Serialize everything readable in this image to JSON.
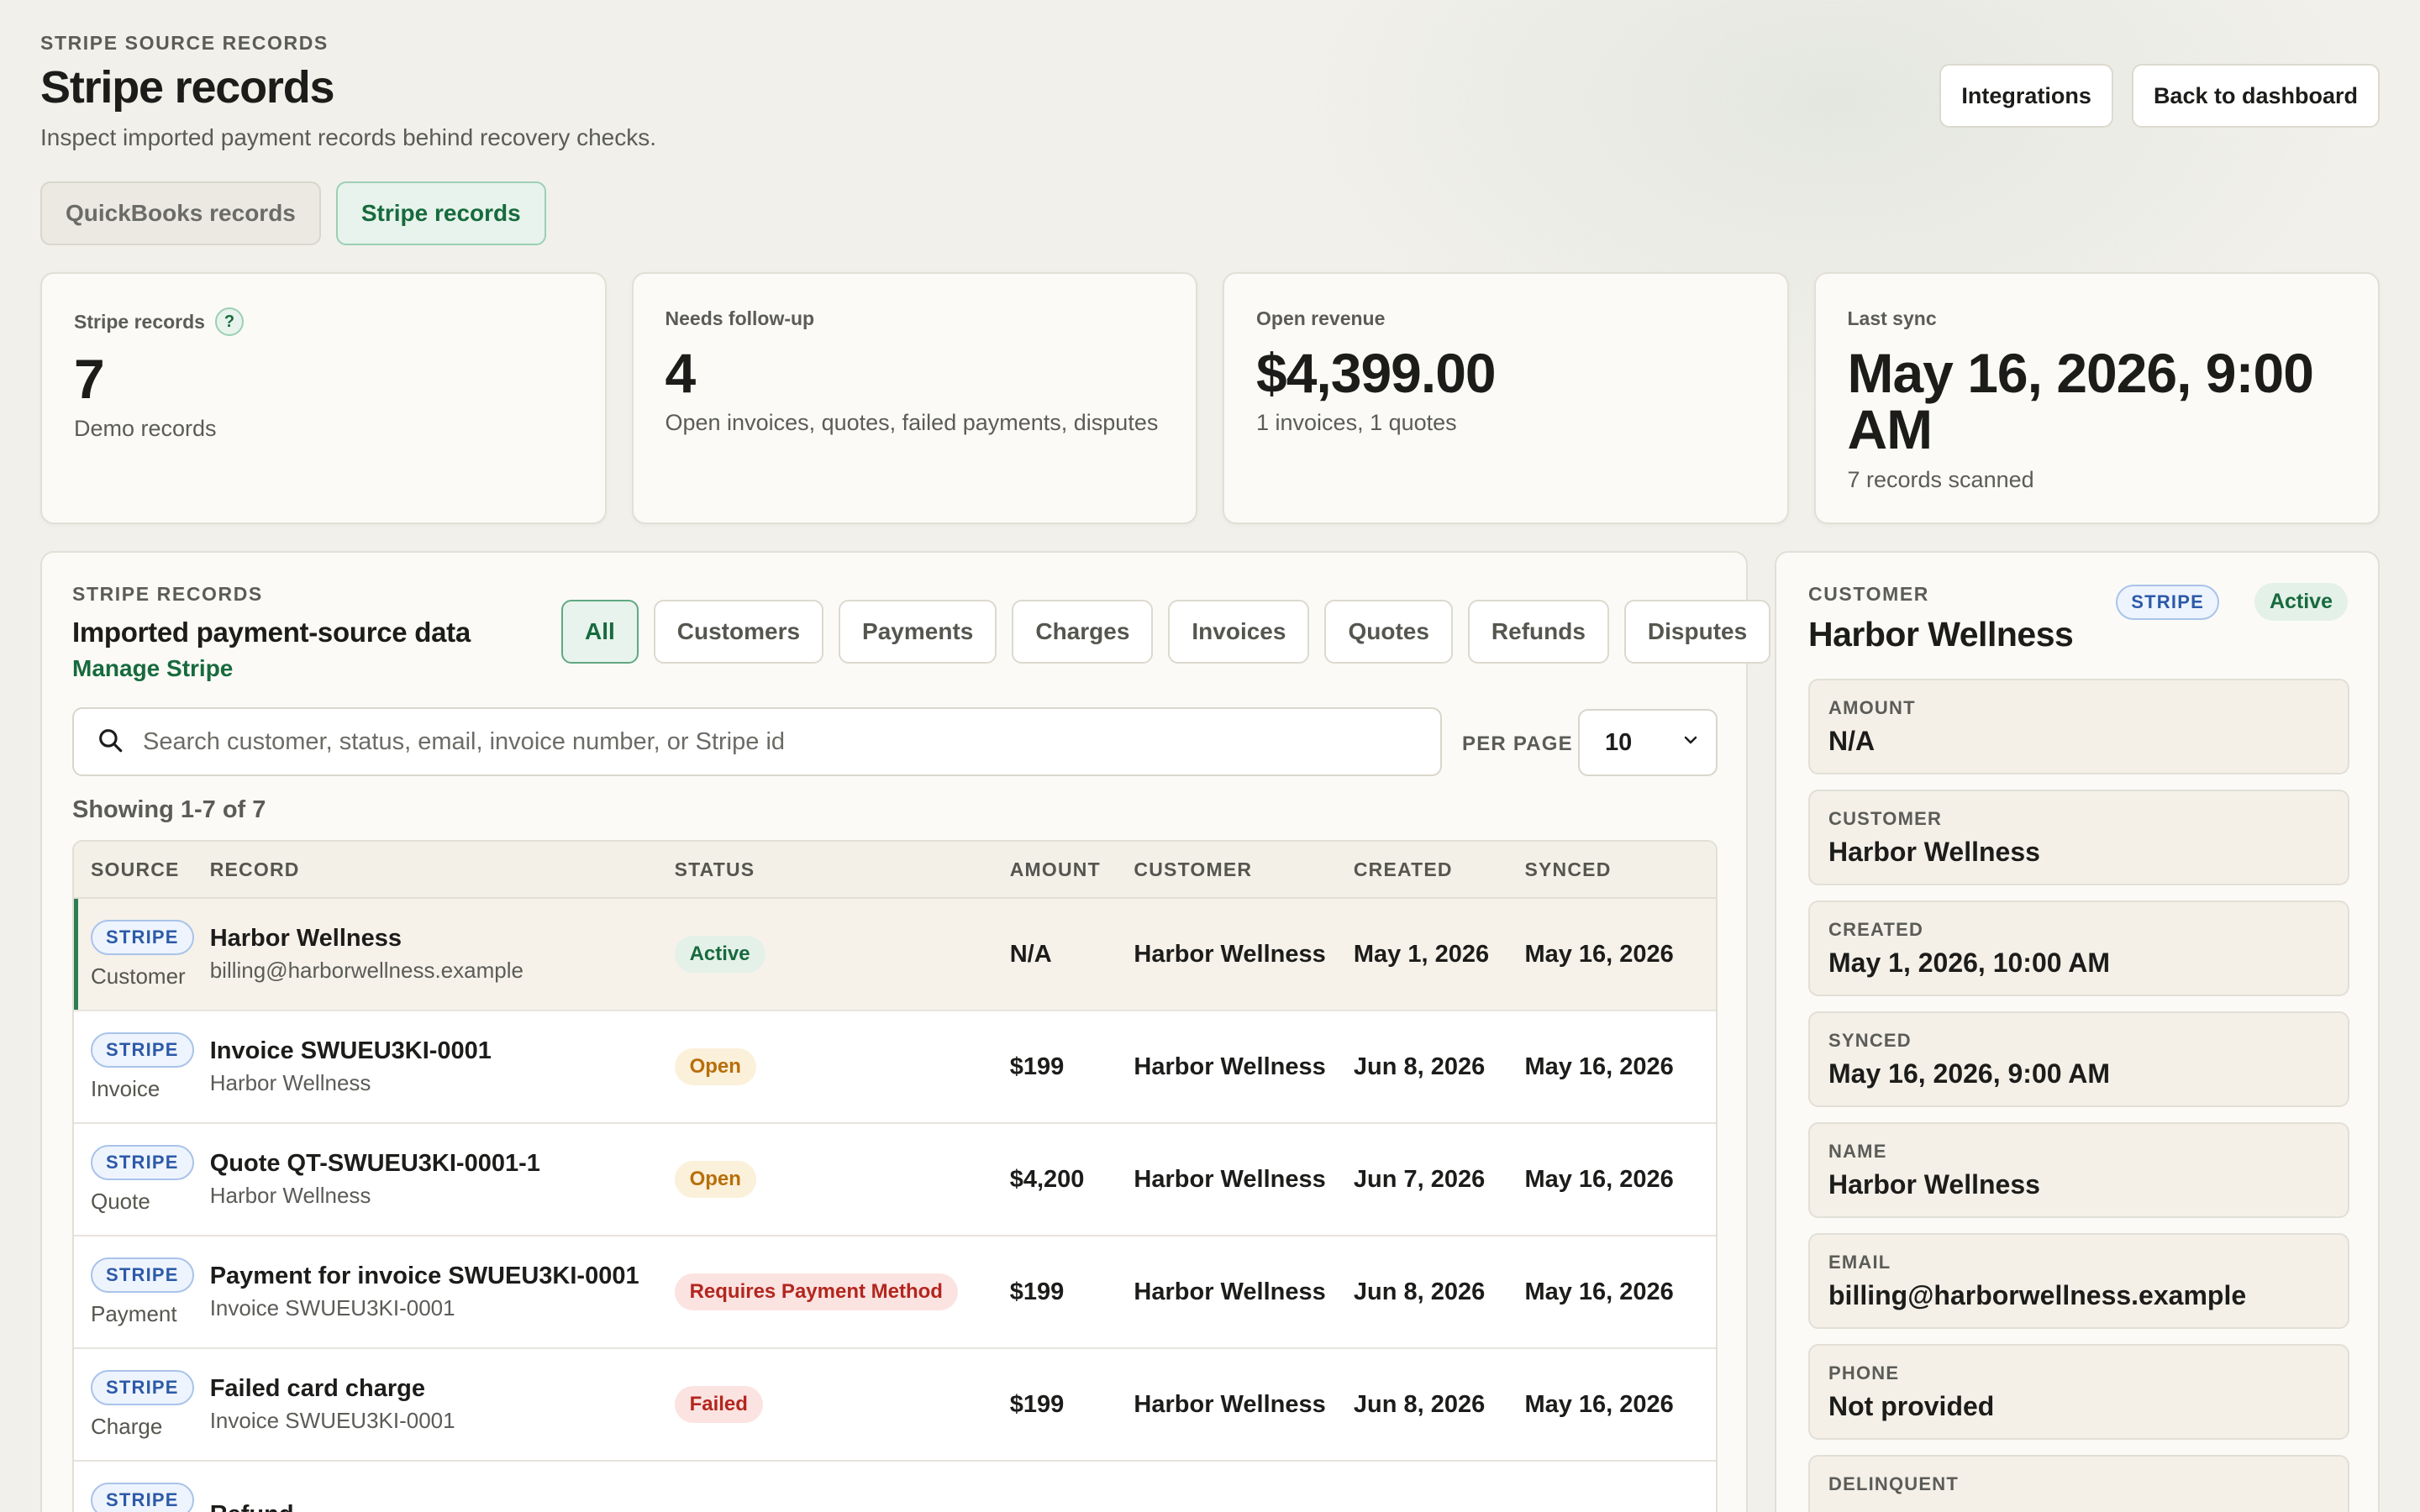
{
  "header": {
    "eyebrow": "STRIPE SOURCE RECORDS",
    "title": "Stripe records",
    "subtitle": "Inspect imported payment records behind recovery checks.",
    "integrations_label": "Integrations",
    "back_label": "Back to dashboard"
  },
  "source_tabs": [
    {
      "label": "QuickBooks records",
      "active": false
    },
    {
      "label": "Stripe records",
      "active": true
    }
  ],
  "stats": [
    {
      "label": "Stripe records",
      "value": "7",
      "desc": "Demo records",
      "help": "?"
    },
    {
      "label": "Needs follow-up",
      "value": "4",
      "desc": "Open invoices, quotes, failed payments, disputes"
    },
    {
      "label": "Open revenue",
      "value": "$4,399.00",
      "desc": "1 invoices, 1 quotes"
    },
    {
      "label": "Last sync",
      "value": "May 16, 2026, 9:00 AM",
      "desc": "7 records scanned"
    }
  ],
  "records_panel": {
    "eyebrow": "STRIPE RECORDS",
    "title": "Imported payment-source data",
    "manage_link": "Manage Stripe",
    "filters": [
      "All",
      "Customers",
      "Payments",
      "Charges",
      "Invoices",
      "Quotes",
      "Refunds",
      "Disputes"
    ],
    "active_filter": "All",
    "search_placeholder": "Search customer, status, email, invoice number, or Stripe id",
    "search_value": "",
    "per_page_label": "PER PAGE",
    "per_page_value": "10",
    "showing": "Showing 1-7 of 7"
  },
  "table": {
    "columns": [
      "SOURCE",
      "RECORD",
      "STATUS",
      "AMOUNT",
      "CUSTOMER",
      "CREATED",
      "SYNCED"
    ],
    "rows": [
      {
        "source": "STRIPE",
        "type": "Customer",
        "title": "Harbor Wellness",
        "sub": "billing@harborwellness.example",
        "status": "Active",
        "status_kind": "active",
        "amount": "N/A",
        "customer": "Harbor Wellness",
        "created": "May 1, 2026",
        "synced": "May 16, 2026",
        "selected": true
      },
      {
        "source": "STRIPE",
        "type": "Invoice",
        "title": "Invoice SWUEU3KI-0001",
        "sub": "Harbor Wellness",
        "status": "Open",
        "status_kind": "open",
        "amount": "$199",
        "customer": "Harbor Wellness",
        "created": "Jun 8, 2026",
        "synced": "May 16, 2026"
      },
      {
        "source": "STRIPE",
        "type": "Quote",
        "title": "Quote QT-SWUEU3KI-0001-1",
        "sub": "Harbor Wellness",
        "status": "Open",
        "status_kind": "open",
        "amount": "$4,200",
        "customer": "Harbor Wellness",
        "created": "Jun 7, 2026",
        "synced": "May 16, 2026"
      },
      {
        "source": "STRIPE",
        "type": "Payment",
        "title": "Payment for invoice SWUEU3KI-0001",
        "sub": "Invoice SWUEU3KI-0001",
        "status": "Requires Payment Method",
        "status_kind": "failed",
        "amount": "$199",
        "customer": "Harbor Wellness",
        "created": "Jun 8, 2026",
        "synced": "May 16, 2026"
      },
      {
        "source": "STRIPE",
        "type": "Charge",
        "title": "Failed card charge",
        "sub": "Invoice SWUEU3KI-0001",
        "status": "Failed",
        "status_kind": "failed",
        "amount": "$199",
        "customer": "Harbor Wellness",
        "created": "Jun 8, 2026",
        "synced": "May 16, 2026"
      },
      {
        "source": "STRIPE",
        "type": "Refund",
        "title": "Refund",
        "sub": "",
        "status": "",
        "status_kind": "active",
        "amount": "",
        "customer": "",
        "created": "",
        "synced": ""
      }
    ]
  },
  "detail": {
    "eyebrow": "CUSTOMER",
    "title": "Harbor Wellness",
    "source_badge": "STRIPE",
    "status": "Active",
    "fields": [
      {
        "label": "AMOUNT",
        "value": "N/A"
      },
      {
        "label": "CUSTOMER",
        "value": "Harbor Wellness"
      },
      {
        "label": "CREATED",
        "value": "May 1, 2026, 10:00 AM"
      },
      {
        "label": "SYNCED",
        "value": "May 16, 2026, 9:00 AM"
      },
      {
        "label": "NAME",
        "value": "Harbor Wellness"
      },
      {
        "label": "EMAIL",
        "value": "billing@harborwellness.example"
      },
      {
        "label": "PHONE",
        "value": "Not provided"
      },
      {
        "label": "DELINQUENT",
        "value": ""
      }
    ]
  }
}
